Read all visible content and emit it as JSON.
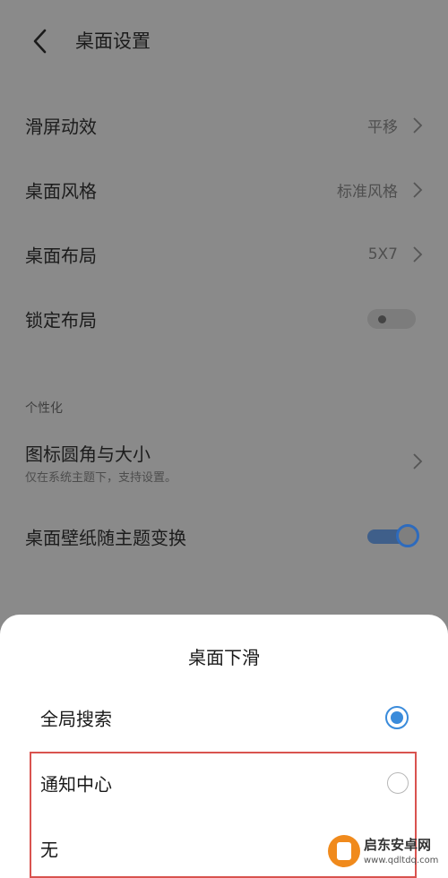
{
  "header": {
    "title": "桌面设置"
  },
  "settings": [
    {
      "label": "滑屏动效",
      "value": "平移"
    },
    {
      "label": "桌面风格",
      "value": "标准风格"
    },
    {
      "label": "桌面布局",
      "value": "5X7"
    },
    {
      "label": "锁定布局",
      "toggle": false
    }
  ],
  "personalization": {
    "section_title": "个性化",
    "icon_row": {
      "label": "图标圆角与大小",
      "sub": "仅在系统主题下，支持设置。"
    },
    "wallpaper_row": {
      "label": "桌面壁纸随主题变换",
      "toggle": true
    }
  },
  "sheet": {
    "title": "桌面下滑",
    "options": [
      {
        "label": "全局搜索",
        "selected": true
      },
      {
        "label": "通知中心",
        "selected": false
      },
      {
        "label": "无",
        "selected": false
      }
    ]
  },
  "watermark": {
    "name": "启东安卓网",
    "url": "www.qdltdq.com"
  },
  "colors": {
    "accent": "#3a8bdb",
    "highlight": "#d9534f"
  }
}
